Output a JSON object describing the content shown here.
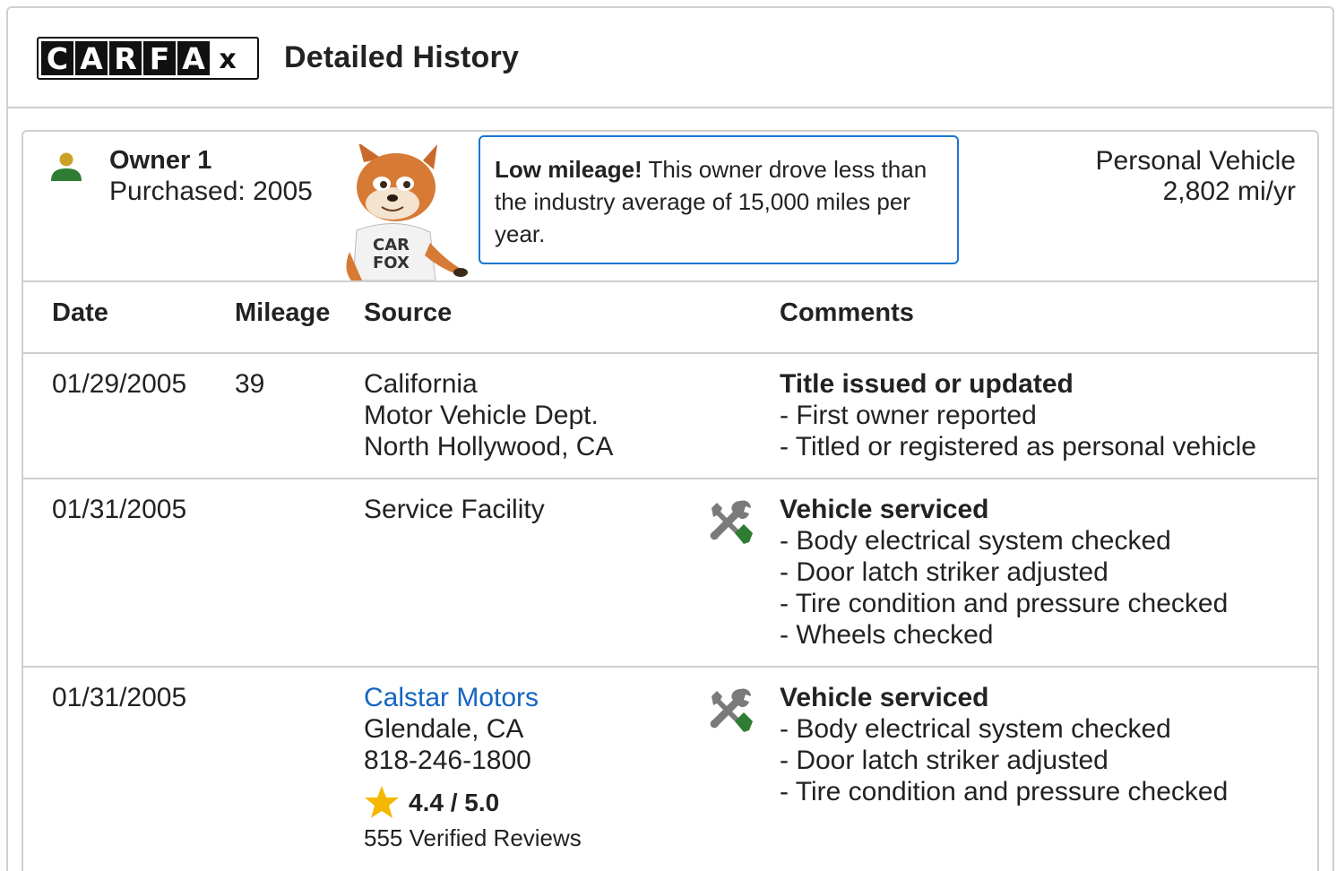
{
  "header": {
    "logo_letters": [
      "C",
      "A",
      "R",
      "F",
      "A",
      "X"
    ],
    "title": "Detailed History"
  },
  "owner": {
    "name": "Owner 1",
    "purchased": "Purchased: 2005",
    "callout_bold": "Low mileage!",
    "callout_text": " This owner drove less than the industry average of 15,000 miles per year.",
    "vehicle_type": "Personal Vehicle",
    "mileage_per_year": "2,802 mi/yr",
    "icon_color": "#2e7d32",
    "icon_head_color": "#c9a227"
  },
  "table": {
    "columns": {
      "date": "Date",
      "mileage": "Mileage",
      "source": "Source",
      "comments": "Comments"
    },
    "rows": [
      {
        "date": "01/29/2005",
        "mileage": "39",
        "source": [
          "California",
          "Motor Vehicle Dept.",
          "North Hollywood, CA"
        ],
        "icon": "",
        "comment_title": "Title issued or updated",
        "comment_items": [
          "- First owner reported",
          "- Titled or registered as personal vehicle"
        ]
      },
      {
        "date": "01/31/2005",
        "mileage": "",
        "source": [
          "Service Facility"
        ],
        "icon": "wrench-screwdriver-icon",
        "comment_title": "Vehicle serviced",
        "comment_items": [
          "- Body electrical system checked",
          "- Door latch striker adjusted",
          "- Tire condition and pressure checked",
          "- Wheels checked"
        ]
      },
      {
        "date": "01/31/2005",
        "mileage": "",
        "source_link": "Calstar Motors",
        "source": [
          "Glendale, CA",
          "818-246-1800"
        ],
        "rating": "4.4 / 5.0",
        "reviews": "555 Verified Reviews",
        "icon": "wrench-screwdriver-icon",
        "comment_title": "Vehicle serviced",
        "comment_items": [
          "- Body electrical system checked",
          "- Door latch striker adjusted",
          "- Tire condition and pressure checked"
        ]
      }
    ]
  },
  "colors": {
    "link": "#1565c0",
    "callout_border": "#1976d2",
    "star": "#f5b800",
    "tool_gray": "#7a7a7a",
    "tool_green": "#2e7d32"
  }
}
